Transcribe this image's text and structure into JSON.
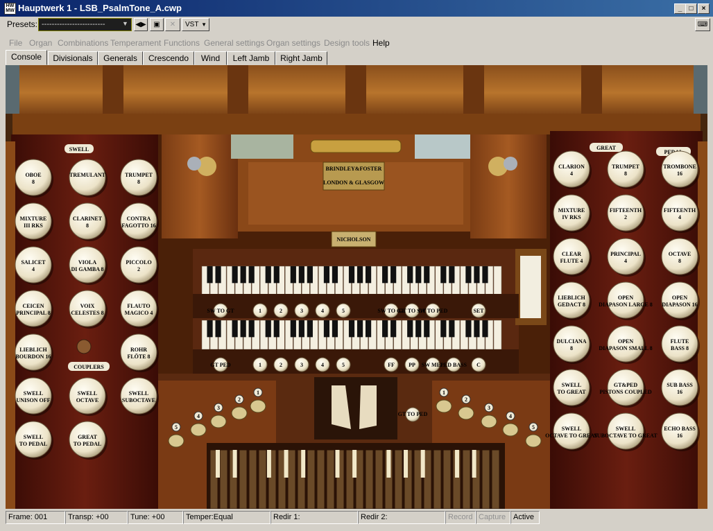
{
  "window": {
    "title": "Hauptwerk 1 - LSB_PsalmTone_A.cwp",
    "min": "_",
    "max": "□",
    "close": "×"
  },
  "toolbar": {
    "presets_label": "Presets:",
    "presets_value": "-------------------------",
    "vst_label": "VST"
  },
  "menu": [
    {
      "label": "File",
      "enabled": false
    },
    {
      "label": "Organ",
      "enabled": false
    },
    {
      "label": "Combinations",
      "enabled": false
    },
    {
      "label": "Temperament",
      "enabled": false
    },
    {
      "label": "Functions",
      "enabled": false
    },
    {
      "label": "General settings",
      "enabled": false
    },
    {
      "label": "Organ settings",
      "enabled": false
    },
    {
      "label": "Design tools",
      "enabled": false
    },
    {
      "label": "Help",
      "enabled": true
    }
  ],
  "tabs": [
    "Console",
    "Divisionals",
    "Generals",
    "Crescendo",
    "Wind",
    "Left Jamb",
    "Right Jamb"
  ],
  "console": {
    "left_jamb": {
      "swell_label": "SWELL",
      "couplers_label": "COUPLERS",
      "stops": [
        [
          "OBOE",
          "8"
        ],
        [
          "TREMULANT",
          ""
        ],
        [
          "TRUMPET",
          "8"
        ],
        [
          "MIXTURE",
          "III RKS"
        ],
        [
          "CLARINET",
          "8"
        ],
        [
          "CONTRA",
          "FAGOTTO 16"
        ],
        [
          "SALICET",
          "4"
        ],
        [
          "VIOLA",
          "DI GAMBA 8"
        ],
        [
          "PICCOLO",
          "2"
        ],
        [
          "CEICEN",
          "PRINCIPAL 8"
        ],
        [
          "VOIX",
          "CELESTES 8"
        ],
        [
          "FLAUTO",
          "MAGICO 4"
        ],
        [
          "LIEBLICH",
          "BOURDON 16"
        ],
        [
          "",
          ""
        ],
        [
          "ROHR",
          "FLÖTE 8"
        ],
        [
          "SWELL",
          "UNISON OFF"
        ],
        [
          "SWELL",
          "OCTAVE"
        ],
        [
          "SWELL",
          "SUBOCTAVE"
        ],
        [
          "SWELL",
          "TO PEDAL"
        ],
        [
          "GREAT",
          "TO PEDAL"
        ],
        [
          "",
          ""
        ]
      ]
    },
    "right_jamb": {
      "great_label": "GREAT",
      "pedal_label": "PEDAL",
      "stops": [
        [
          "CLARION",
          "4"
        ],
        [
          "TRUMPET",
          "8"
        ],
        [
          "TROMBONE",
          "16"
        ],
        [
          "MIXTURE",
          "IV RKS"
        ],
        [
          "FIFTEENTH",
          "2"
        ],
        [
          "FIFTEENTH",
          "4"
        ],
        [
          "CLEAR",
          "FLUTE 4"
        ],
        [
          "PRINCIPAL",
          "4"
        ],
        [
          "OCTAVE",
          "8"
        ],
        [
          "LIEBLICH",
          "GEDACT 8"
        ],
        [
          "OPEN",
          "DIAPASON LARGE 8"
        ],
        [
          "OPEN",
          "DIAPASON 16"
        ],
        [
          "DULCIANA",
          "8"
        ],
        [
          "OPEN",
          "DIAPASON SMALL 8"
        ],
        [
          "FLUTE",
          "BASS 8"
        ],
        [
          "SWELL",
          "TO GREAT"
        ],
        [
          "GT&PED",
          "PISTONS COUPLED"
        ],
        [
          "SUB BASS",
          "16"
        ],
        [
          "SWELL",
          "OCTAVE TO GREAT"
        ],
        [
          "SWELL",
          "SUBOCTAVE TO GREAT"
        ],
        [
          "ECHO BASS",
          "16"
        ]
      ]
    },
    "nameplate1": [
      "BRINDLEY & FOSTER",
      "LONDON & GLASGOW"
    ],
    "nameplate2": "NICHOLSON",
    "upper_pistons": [
      "SW TO GT",
      "1",
      "2",
      "3",
      "4",
      "5",
      "SW TO GT",
      "GT TO SW",
      "GT TO PED",
      "SET"
    ],
    "lower_pistons": [
      "GT PED",
      "1",
      "2",
      "3",
      "4",
      "5",
      "FF",
      "PP",
      "SW MEL",
      "PED BASS",
      "C"
    ],
    "toe_left": [
      "5",
      "4",
      "3",
      "2",
      "1"
    ],
    "toe_right": [
      "1",
      "2",
      "3",
      "4",
      "5"
    ],
    "toe_center": "GT TO PED"
  },
  "status": [
    "Frame: 001",
    "Transp: +00",
    "Tune: +00",
    "Temper:Equal",
    "Redir 1:",
    "Redir 2:",
    "Record",
    "Capture",
    "Active"
  ],
  "colors": {
    "title_bar": "#0a246a",
    "wood": "#5a2a0e",
    "ivory": "#f0ead6"
  }
}
